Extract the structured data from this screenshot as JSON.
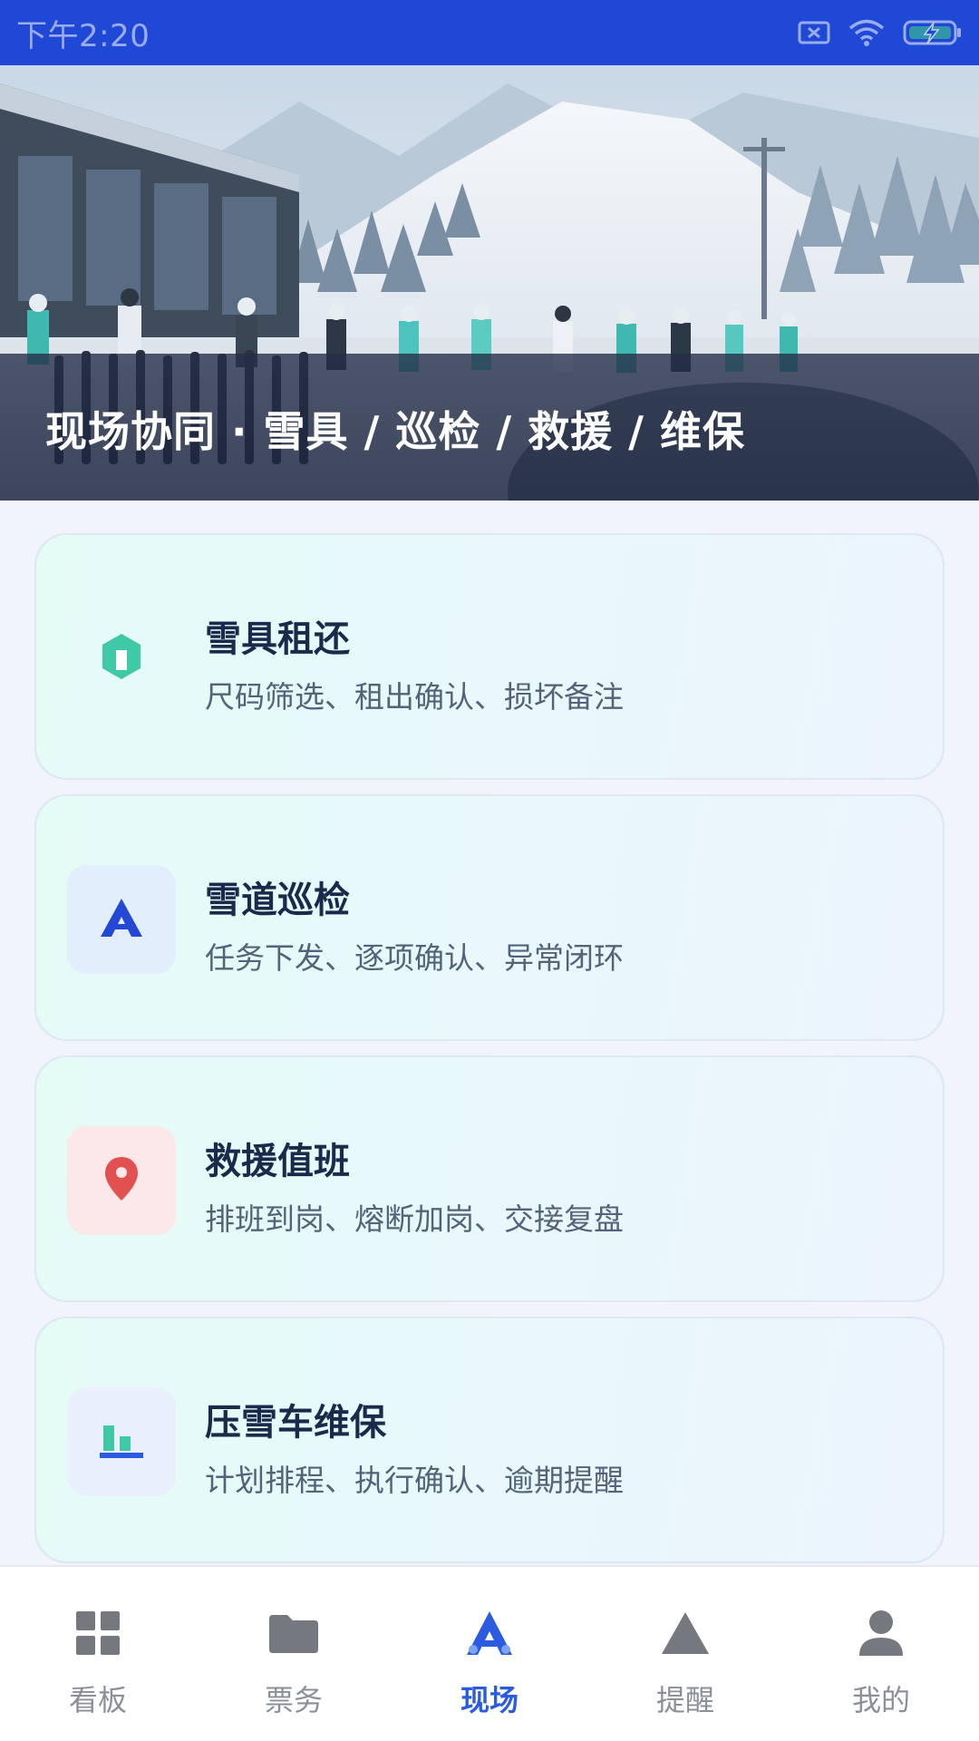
{
  "status_bar": {
    "time": "下午2:20",
    "icons": [
      "sim-off-icon",
      "wifi-icon",
      "battery-charging-icon"
    ]
  },
  "hero": {
    "title": "现场协同 · 雪具 / 巡检 / 救援 / 维保"
  },
  "cards": [
    {
      "title": "雪具租还",
      "desc": "尺码筛选、租出确认、损坏备注",
      "icon": "hexagon-icon",
      "icon_color": "#3FC9A7"
    },
    {
      "title": "雪道巡检",
      "desc": "任务下发、逐项确认、异常闭环",
      "icon": "slope-a-icon",
      "icon_color": "#2448D6"
    },
    {
      "title": "救援值班",
      "desc": "排班到岗、熔断加岗、交接复盘",
      "icon": "location-pin-icon",
      "icon_color": "#E0514F"
    },
    {
      "title": "压雪车维保",
      "desc": "计划排程、执行确认、逾期提醒",
      "icon": "bar-chart-icon",
      "icon_color": "#2A5BE0"
    }
  ],
  "bottom_nav": [
    {
      "label": "看板",
      "icon": "dashboard-grid-icon",
      "active": false
    },
    {
      "label": "票务",
      "icon": "folder-icon",
      "active": false
    },
    {
      "label": "现场",
      "icon": "field-a-icon",
      "active": true
    },
    {
      "label": "提醒",
      "icon": "triangle-alert-icon",
      "active": false
    },
    {
      "label": "我的",
      "icon": "user-icon",
      "active": false
    }
  ],
  "colors": {
    "status_bar": "#2048D6",
    "accent": "#2A5BE0",
    "page_bg": "#F1F4FC"
  }
}
